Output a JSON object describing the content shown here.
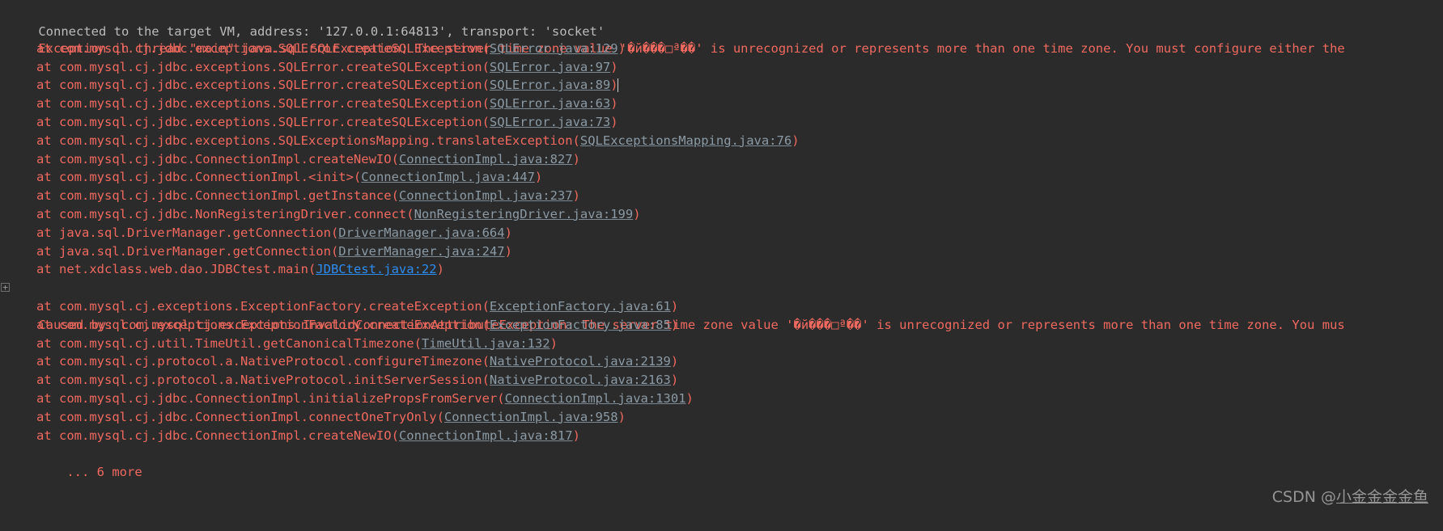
{
  "console": {
    "background_color": "#2b2b2b",
    "info_color": "#bbbbbb",
    "error_color": "#f0695f",
    "link_color": "#8b9aa4",
    "active_link_color": "#2d8cf0",
    "connected_line": "Connected to the target VM, address: '127.0.0.1:64813', transport: 'socket'",
    "exception_header": "Exception in thread \"main\" java.sql.SQLException: The server time zone value '�й���□ª��' is unrecognized or represents more than one time zone. You must configure either the",
    "caused_by_header": "Caused by: com.mysql.cj.exceptions.InvalidConnectionAttributeException: The server time zone value '�й���□ª��' is unrecognized or represents more than one time zone. You mus",
    "fold_marker": "+",
    "trace_primary": [
      {
        "text": "at com.mysql.cj.jdbc.exceptions.SQLError.createSQLException(",
        "link": "SQLError.java:129",
        "tail": ")",
        "hot": false,
        "cursor": false
      },
      {
        "text": "at com.mysql.cj.jdbc.exceptions.SQLError.createSQLException(",
        "link": "SQLError.java:97",
        "tail": ")",
        "hot": false,
        "cursor": false
      },
      {
        "text": "at com.mysql.cj.jdbc.exceptions.SQLError.createSQLException(",
        "link": "SQLError.java:89",
        "tail": ")",
        "hot": false,
        "cursor": true
      },
      {
        "text": "at com.mysql.cj.jdbc.exceptions.SQLError.createSQLException(",
        "link": "SQLError.java:63",
        "tail": ")",
        "hot": false,
        "cursor": false
      },
      {
        "text": "at com.mysql.cj.jdbc.exceptions.SQLError.createSQLException(",
        "link": "SQLError.java:73",
        "tail": ")",
        "hot": false,
        "cursor": false
      },
      {
        "text": "at com.mysql.cj.jdbc.exceptions.SQLExceptionsMapping.translateException(",
        "link": "SQLExceptionsMapping.java:76",
        "tail": ")",
        "hot": false,
        "cursor": false
      },
      {
        "text": "at com.mysql.cj.jdbc.ConnectionImpl.createNewIO(",
        "link": "ConnectionImpl.java:827",
        "tail": ")",
        "hot": false,
        "cursor": false
      },
      {
        "text": "at com.mysql.cj.jdbc.ConnectionImpl.<init>(",
        "link": "ConnectionImpl.java:447",
        "tail": ")",
        "hot": false,
        "cursor": false
      },
      {
        "text": "at com.mysql.cj.jdbc.ConnectionImpl.getInstance(",
        "link": "ConnectionImpl.java:237",
        "tail": ")",
        "hot": false,
        "cursor": false
      },
      {
        "text": "at com.mysql.cj.jdbc.NonRegisteringDriver.connect(",
        "link": "NonRegisteringDriver.java:199",
        "tail": ")",
        "hot": false,
        "cursor": false
      },
      {
        "text": "at java.sql.DriverManager.getConnection(",
        "link": "DriverManager.java:664",
        "tail": ")",
        "hot": false,
        "cursor": false
      },
      {
        "text": "at java.sql.DriverManager.getConnection(",
        "link": "DriverManager.java:247",
        "tail": ")",
        "hot": false,
        "cursor": false
      },
      {
        "text": "at net.xdclass.web.dao.JDBCtest.main(",
        "link": "JDBCtest.java:22",
        "tail": ")",
        "hot": true,
        "cursor": false
      }
    ],
    "trace_caused": [
      {
        "text": "at com.mysql.cj.exceptions.ExceptionFactory.createException(",
        "link": "ExceptionFactory.java:61",
        "tail": ")",
        "hot": false,
        "cursor": false
      },
      {
        "text": "at com.mysql.cj.exceptions.ExceptionFactory.createException(",
        "link": "ExceptionFactory.java:85",
        "tail": ")",
        "hot": false,
        "cursor": false
      },
      {
        "text": "at com.mysql.cj.util.TimeUtil.getCanonicalTimezone(",
        "link": "TimeUtil.java:132",
        "tail": ")",
        "hot": false,
        "cursor": false
      },
      {
        "text": "at com.mysql.cj.protocol.a.NativeProtocol.configureTimezone(",
        "link": "NativeProtocol.java:2139",
        "tail": ")",
        "hot": false,
        "cursor": false
      },
      {
        "text": "at com.mysql.cj.protocol.a.NativeProtocol.initServerSession(",
        "link": "NativeProtocol.java:2163",
        "tail": ")",
        "hot": false,
        "cursor": false
      },
      {
        "text": "at com.mysql.cj.jdbc.ConnectionImpl.initializePropsFromServer(",
        "link": "ConnectionImpl.java:1301",
        "tail": ")",
        "hot": false,
        "cursor": false
      },
      {
        "text": "at com.mysql.cj.jdbc.ConnectionImpl.connectOneTryOnly(",
        "link": "ConnectionImpl.java:958",
        "tail": ")",
        "hot": false,
        "cursor": false
      },
      {
        "text": "at com.mysql.cj.jdbc.ConnectionImpl.createNewIO(",
        "link": "ConnectionImpl.java:817",
        "tail": ")",
        "hot": false,
        "cursor": false
      }
    ],
    "more_line": "... 6 more"
  },
  "watermark": {
    "prefix": "CSDN @",
    "user": "小金金金金鱼"
  }
}
